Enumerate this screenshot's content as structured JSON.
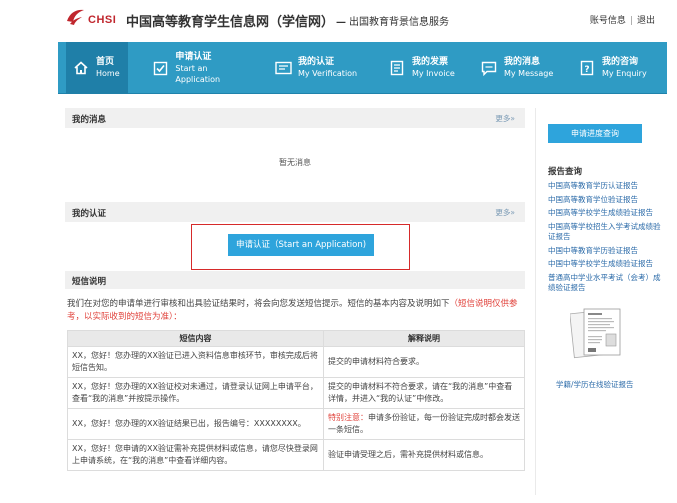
{
  "header": {
    "logo_text": "CHSI",
    "title": "中国高等教育学生信息网（学信网）",
    "sub_dash": "—",
    "subtitle": "出国教育背景信息服务",
    "account_info": "账号信息",
    "separator": "|",
    "logout": "退出"
  },
  "nav": [
    {
      "cn": "首页",
      "en": "Home",
      "icon": "home-icon"
    },
    {
      "cn": "申请认证",
      "en": "Start an Application",
      "icon": "checkbox-icon"
    },
    {
      "cn": "我的认证",
      "en": "My Verification",
      "icon": "certificate-icon"
    },
    {
      "cn": "我的发票",
      "en": "My Invoice",
      "icon": "invoice-icon"
    },
    {
      "cn": "我的消息",
      "en": "My Message",
      "icon": "message-icon"
    },
    {
      "cn": "我的咨询",
      "en": "My Enquiry",
      "icon": "question-icon"
    }
  ],
  "messages": {
    "title": "我的消息",
    "more": "更多»",
    "empty": "暂无消息"
  },
  "verification": {
    "title": "我的认证",
    "more": "更多»",
    "apply_button": "申请认证（Start an Application)"
  },
  "sms": {
    "title": "短信说明",
    "desc_main": "我们在对您的申请单进行审核和出具验证结果时，将会向您发送短信提示。短信的基本内容及说明如下",
    "desc_note": "（短信说明仅供参考，以实际收到的短信为准）：",
    "col_content": "短信内容",
    "col_explain": "解释说明",
    "rows": [
      {
        "content": "XX，您好！您办理的XX验证已进入资料信息审核环节，审核完成后将短信告知。",
        "note_prefix": "",
        "explain": "提交的申请材料符合要求。"
      },
      {
        "content": "XX，您好！您办理的XX验证校对未通过，请登录认证网上申请平台，查看“我的消息”并按提示操作。",
        "note_prefix": "",
        "explain": "提交的申请材料不符合要求，请在“我的消息”中查看详情，并进入“我的认证”中修改。"
      },
      {
        "content": "XX，您好！您办理的XX验证结果已出，报告编号：XXXXXXXX。",
        "note_prefix": "特别注意：",
        "explain": "申请多份验证，每一份验证完成时都会发送一条短信。"
      },
      {
        "content": "XX，您好！您申请的XX验证需补充提供材料或信息，请您尽快登录网上申请系统，在“我的消息”中查看详细内容。",
        "note_prefix": "",
        "explain": "验证申请受理之后，需补充提供材料或信息。"
      }
    ]
  },
  "sidebar": {
    "query_button": "申请进度查询",
    "reports_title": "报告查询",
    "links": [
      "中国高等教育学历认证报告",
      "中国高等教育学位验证报告",
      "中国高等学校学生成绩验证报告",
      "中国高等学校招生入学考试成绩验证报告",
      "中国中等教育学历验证报告",
      "中国中等学校学生成绩验证报告",
      "普通高中学业水平考试（会考）成绩验证报告"
    ],
    "cert_caption": "学籍/学历在线验证报告"
  },
  "colors": {
    "nav_bg": "#2f9bc4",
    "nav_active": "#1f7fa8",
    "button": "#2ea4dc",
    "highlight_border": "#d62a2a",
    "brand_red": "#c0262d",
    "link": "#2a6aa8"
  }
}
